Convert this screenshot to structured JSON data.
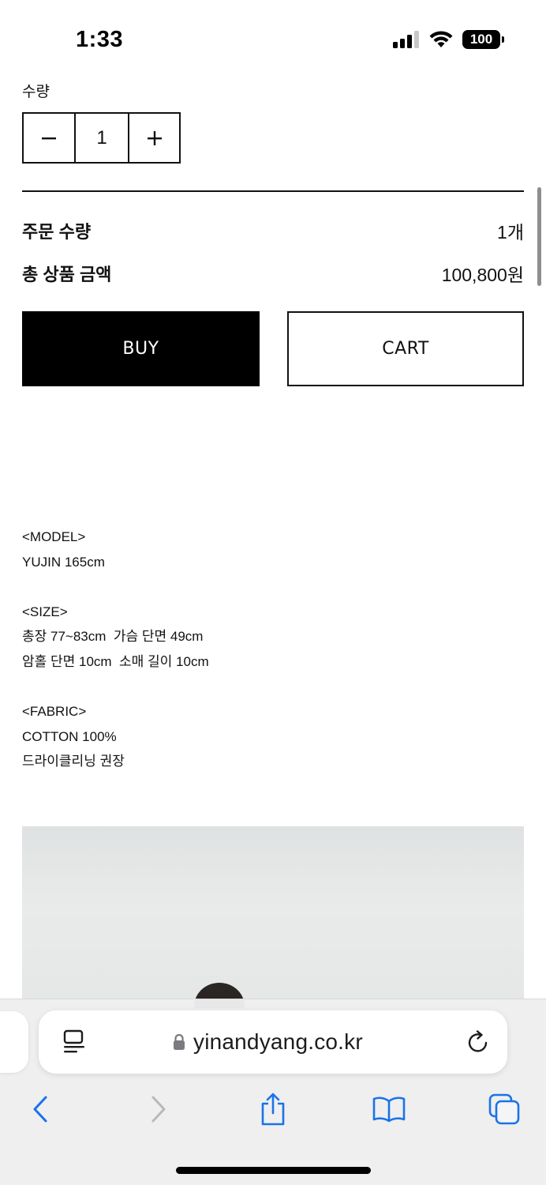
{
  "status_bar": {
    "time": "1:33",
    "battery": "100"
  },
  "product_options": {
    "quantity_label": "수량",
    "stepper": {
      "minus_icon": "minus-icon",
      "value": "1",
      "plus_icon": "plus-icon"
    }
  },
  "summary": {
    "order_quantity_label": "주문 수량",
    "order_quantity_value": "1개",
    "total_price_label": "총 상품 금액",
    "total_price_value": "100,800원"
  },
  "actions": {
    "buy_label": "BUY",
    "cart_label": "CART"
  },
  "description": {
    "lines": [
      "<MODEL>",
      "YUJIN 165cm",
      "",
      "<SIZE>",
      "총장 77~83cm  가슴 단면 49cm",
      "암홀 단면 10cm  소매 길이 10cm",
      "",
      "<FABRIC>",
      "COTTON 100%",
      "드라이클리닝 권장"
    ]
  },
  "browser": {
    "url": "yinandyang.co.kr",
    "icons": {
      "page_menu": "page-menu-icon",
      "lock": "lock-icon",
      "reload": "reload-icon",
      "back": "chevron-left-icon",
      "forward": "chevron-right-icon",
      "share": "share-icon",
      "bookmarks": "book-icon",
      "tabs": "tabs-icon"
    },
    "accent_color": "#1a73e8"
  }
}
